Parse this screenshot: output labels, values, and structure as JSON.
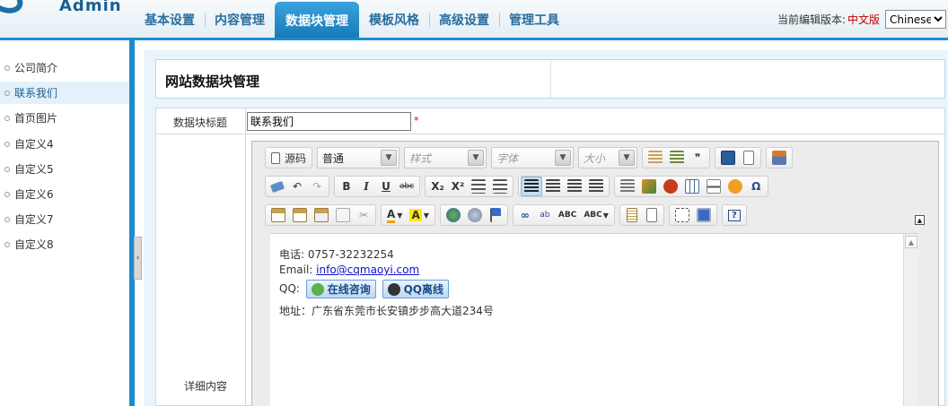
{
  "header": {
    "logo_text": "Admin",
    "tabs": [
      {
        "label": "基本设置"
      },
      {
        "label": "内容管理"
      },
      {
        "label": "数据块管理"
      },
      {
        "label": "模板风格"
      },
      {
        "label": "高级设置"
      },
      {
        "label": "管理工具"
      }
    ],
    "active_tab": "数据块管理",
    "version_label": "当前编辑版本:",
    "version_current": "中文版",
    "language_select": "Chinese",
    "accent_color": "#1a8ccf"
  },
  "sidebar": {
    "items": [
      {
        "label": "公司简介"
      },
      {
        "label": "联系我们"
      },
      {
        "label": "首页图片"
      },
      {
        "label": "自定义4"
      },
      {
        "label": "自定义5"
      },
      {
        "label": "自定义6"
      },
      {
        "label": "自定义7"
      },
      {
        "label": "自定义8"
      }
    ],
    "active_item": "联系我们",
    "collapse_glyph": "‹"
  },
  "main": {
    "title": "网站数据块管理",
    "form": {
      "title_label": "数据块标题",
      "title_value": "联系我们",
      "required_mark": "*",
      "content_label": "详细内容"
    }
  },
  "editor": {
    "source_label": "源码",
    "format_value": "普通",
    "style_placeholder": "样式",
    "font_placeholder": "字体",
    "size_placeholder": "大小",
    "toolbar_glyphs": {
      "bold": "B",
      "italic": "I",
      "underline": "U",
      "strike": "abc",
      "subscript": "X₂",
      "superscript": "X²",
      "omega": "Ω",
      "quote": "❞",
      "help": "?"
    },
    "content": {
      "phone_line": "电话: 0757-32232254",
      "email_prefix": "Email: ",
      "email_link": "info@cqmaoyi.com",
      "qq_prefix": "QQ:",
      "qq_online": "在线咨询",
      "qq_offline": "QQ离线",
      "address_line": "地址：广东省东莞市长安镇步步高大道234号"
    }
  }
}
